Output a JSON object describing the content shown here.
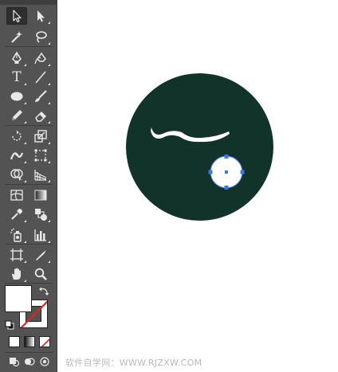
{
  "app": {
    "tools": [
      {
        "name": "selection-tool",
        "icon": "arrow-icon"
      },
      {
        "name": "direct-selection-tool",
        "icon": "white-arrow-icon"
      },
      {
        "name": "magic-wand-tool",
        "icon": "magic-wand-icon"
      },
      {
        "name": "lasso-tool",
        "icon": "lasso-icon"
      },
      {
        "name": "pen-tool",
        "icon": "pen-icon"
      },
      {
        "name": "curvature-tool",
        "icon": "curvature-pen-icon"
      },
      {
        "name": "type-tool",
        "icon": "type-icon",
        "glyph": "T"
      },
      {
        "name": "line-segment-tool",
        "icon": "line-icon"
      },
      {
        "name": "ellipse-tool",
        "icon": "ellipse-icon"
      },
      {
        "name": "paintbrush-tool",
        "icon": "brush-icon"
      },
      {
        "name": "pencil-tool",
        "icon": "pencil-icon"
      },
      {
        "name": "eraser-tool",
        "icon": "eraser-icon"
      },
      {
        "name": "rotate-tool",
        "icon": "rotate-icon"
      },
      {
        "name": "scale-tool",
        "icon": "scale-icon"
      },
      {
        "name": "width-tool",
        "icon": "width-icon"
      },
      {
        "name": "free-transform-tool",
        "icon": "free-transform-icon"
      },
      {
        "name": "shape-builder-tool",
        "icon": "shape-builder-icon"
      },
      {
        "name": "perspective-grid-tool",
        "icon": "perspective-grid-icon"
      },
      {
        "name": "mesh-tool",
        "icon": "mesh-icon"
      },
      {
        "name": "gradient-tool",
        "icon": "gradient-icon"
      },
      {
        "name": "eyedropper-tool",
        "icon": "eyedropper-icon"
      },
      {
        "name": "blend-tool",
        "icon": "blend-icon"
      },
      {
        "name": "symbol-sprayer-tool",
        "icon": "symbol-sprayer-icon"
      },
      {
        "name": "column-graph-tool",
        "icon": "column-graph-icon"
      },
      {
        "name": "artboard-tool",
        "icon": "artboard-icon"
      },
      {
        "name": "slice-tool",
        "icon": "slice-icon"
      },
      {
        "name": "hand-tool",
        "icon": "hand-icon"
      },
      {
        "name": "zoom-tool",
        "icon": "zoom-icon"
      }
    ],
    "colors": {
      "toolbar": "#535353",
      "canvas": "#ffffff",
      "circle_fill": "#11332a",
      "selection_blue": "#3a78f2"
    },
    "fill_color": "#ffffff",
    "stroke_color": "none"
  },
  "watermark": "软件自学网：WWW.RJZXW.COM"
}
